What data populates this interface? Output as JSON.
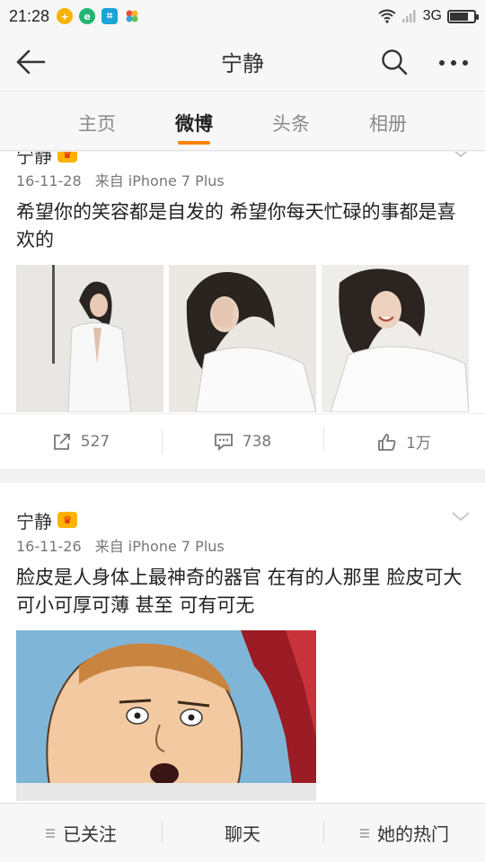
{
  "status_bar": {
    "time": "21:28",
    "network": "3G",
    "app_icons": [
      "plus-app-icon",
      "browser-app-icon",
      "scanner-app-icon",
      "pinwheel-app-icon"
    ],
    "battery_level": 0.75
  },
  "nav": {
    "title": "宁静",
    "icons": [
      "back-arrow-icon",
      "search-icon",
      "more-icon"
    ]
  },
  "tabs": [
    {
      "label": "主页",
      "active": false
    },
    {
      "label": "微博",
      "active": true
    },
    {
      "label": "头条",
      "active": false
    },
    {
      "label": "相册",
      "active": false
    }
  ],
  "posts": [
    {
      "author": "宁静",
      "date": "16-11-28",
      "source": "来自 iPhone 7 Plus",
      "text": "希望你的笑容都是自发的 希望你每天忙碌的事都是喜欢的",
      "photos": 3,
      "reposts": "527",
      "comments": "738",
      "likes": "1万"
    },
    {
      "author": "宁静",
      "date": "16-11-26",
      "source": "来自 iPhone 7 Plus",
      "text": "脸皮是人身体上最神奇的器官 在有的人那里 脸皮可大可小可厚可薄 甚至 可有可无"
    }
  ],
  "bottom_bar": {
    "follow": "已关注",
    "chat": "聊天",
    "hot": "她的热门"
  },
  "colors": {
    "accent": "#ff8200",
    "background": "#f2f2f2"
  }
}
